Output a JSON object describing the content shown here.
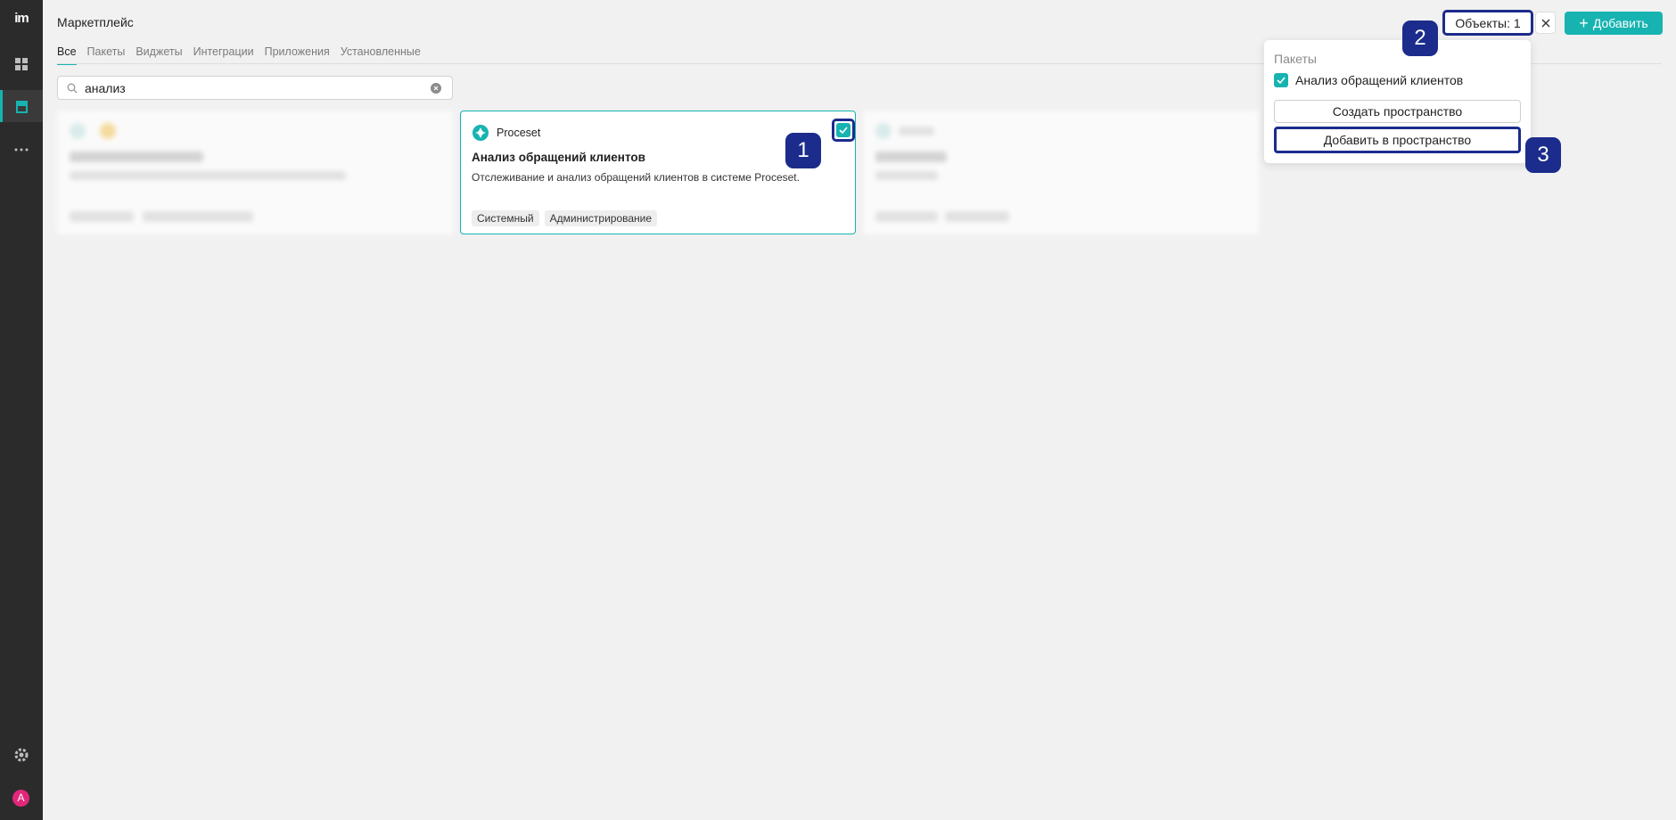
{
  "sidebar": {
    "logo": "im",
    "avatar_letter": "A"
  },
  "header": {
    "title": "Маркетплейс",
    "objects_label": "Объекты: 1",
    "add_label": "Добавить",
    "tabs": [
      {
        "label": "Все",
        "active": true
      },
      {
        "label": "Пакеты"
      },
      {
        "label": "Виджеты"
      },
      {
        "label": "Интеграции"
      },
      {
        "label": "Приложения"
      },
      {
        "label": "Установленные"
      }
    ]
  },
  "search": {
    "value": "анализ"
  },
  "cards": [
    {
      "vendor": "Proceset",
      "title": "Анализ обращений клиентов",
      "description": "Отслеживание и анализ обращений клиентов в системе Proceset.",
      "tags": [
        "Системный",
        "Администрирование"
      ],
      "selected": true
    }
  ],
  "popup": {
    "heading": "Пакеты",
    "item_label": "Анализ обращений клиентов",
    "create_label": "Создать пространство",
    "add_label": "Добавить в пространство"
  },
  "badges": [
    "1",
    "2",
    "3"
  ],
  "colors": {
    "accent": "#17b3b0",
    "highlight": "#1c2c8c",
    "sidebar": "#2b2b2b"
  }
}
